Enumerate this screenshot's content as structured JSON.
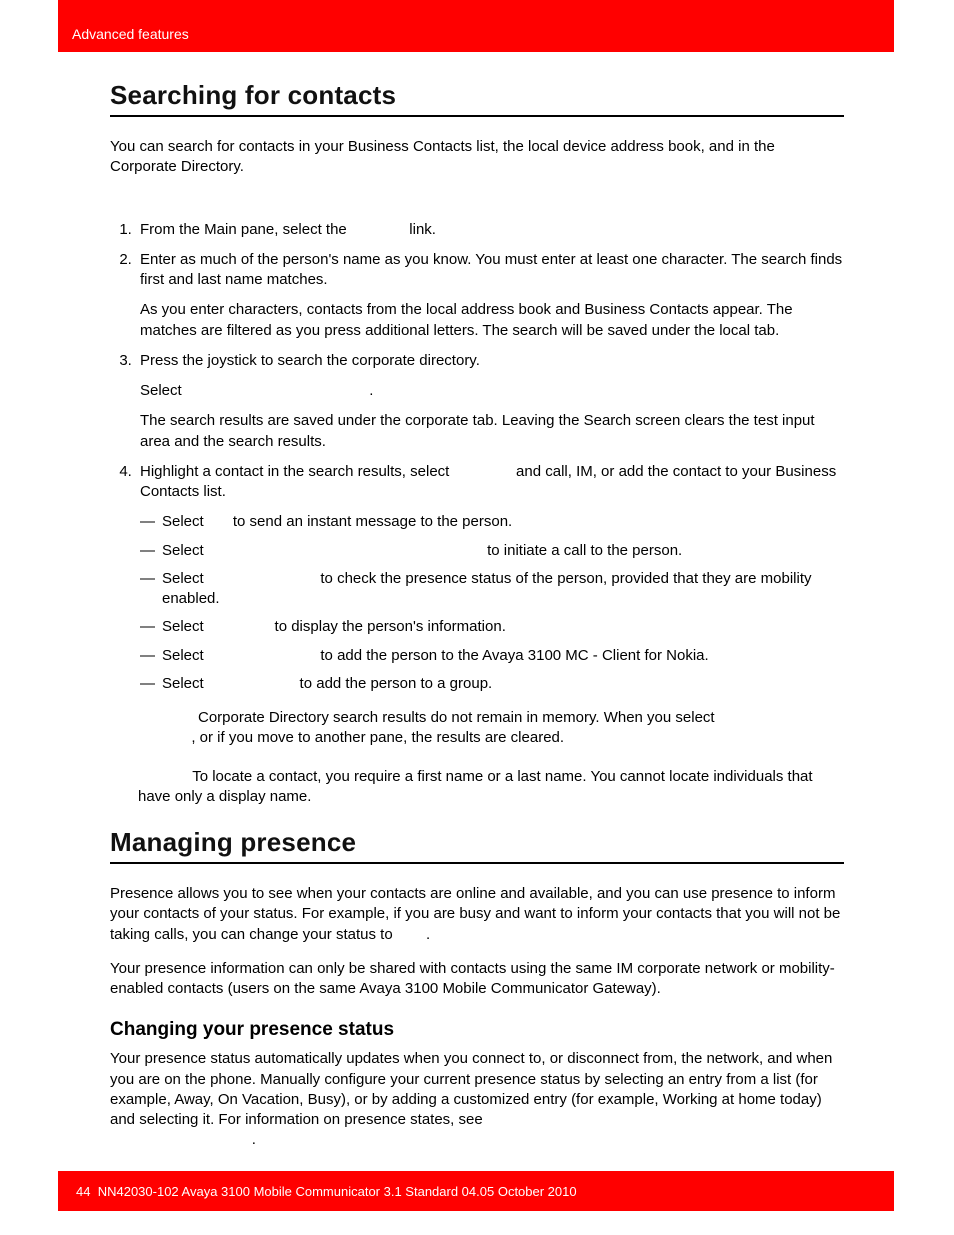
{
  "header": {
    "breadcrumb": "Advanced features"
  },
  "section1": {
    "title": "Searching for contacts",
    "intro": "You can search for contacts in your Business Contacts list, the local device address book, and in the Corporate Directory.",
    "steps": {
      "s1a": "From the Main pane, select the ",
      "s1b": " link.",
      "s2a": "Enter as much of the person's name as you know. You must enter at least one character. The search finds first and last name matches.",
      "s2b": "As you enter characters, contacts from the local address book and Business Contacts appear. The matches are filtered as you press additional letters. The search will be saved under the local tab.",
      "s3a": "Press the joystick to search the corporate directory.",
      "s3b": "Select ",
      "s3c": ".",
      "s3d": "The search results are saved under the corporate tab. Leaving the Search screen clears the test input area and the search results.",
      "s4a": "Highlight a contact in the search results, select ",
      "s4b": " and call, IM, or add the contact to your Business Contacts list.",
      "d1a": "Select ",
      "d1b": " to send an instant message to the person.",
      "d2a": "Select ",
      "d2b": " to initiate a call to the person.",
      "d3a": "Select ",
      "d3b": " to check the presence status of the person, provided that they are mobility enabled.",
      "d4a": "Select ",
      "d4b": " to display the person's information.",
      "d5a": "Select ",
      "d5b": " to add the person to the Avaya 3100 MC - Client for Nokia.",
      "d6a": "Select ",
      "d6b": " to add the person to a group."
    },
    "note1a": "Corporate Directory search results do not remain in memory. When you select ",
    "note1b": ", or if you move to another pane, the results are cleared.",
    "note2": "To locate a contact, you require a first name or a last name. You cannot locate individuals that have only a display name."
  },
  "section2": {
    "title": "Managing presence",
    "p1a": "Presence allows you to see when your contacts are online and available, and you can use presence to inform your contacts of your status. For example, if you are busy and want to inform your contacts that you will not be taking calls, you can change your status to ",
    "p1b": ".",
    "p2": "Your presence information can only be shared with contacts using the same IM corporate network or mobility-enabled contacts (users on the same Avaya 3100 Mobile Communicator Gateway).",
    "sub": "Changing your presence status",
    "p3a": "Your presence status automatically updates when you connect to, or disconnect from, the network, and when you are on the phone. Manually configure your current presence status by selecting an entry from a list (for example, Away, On Vacation, Busy), or by adding a customized entry (for example, Working at home today) and selecting it. For information on presence states, see ",
    "p3b": "."
  },
  "footer": {
    "page": "44",
    "text": "NN42030-102 Avaya 3100 Mobile Communicator 3.1 Standard 04.05 October 2010"
  }
}
